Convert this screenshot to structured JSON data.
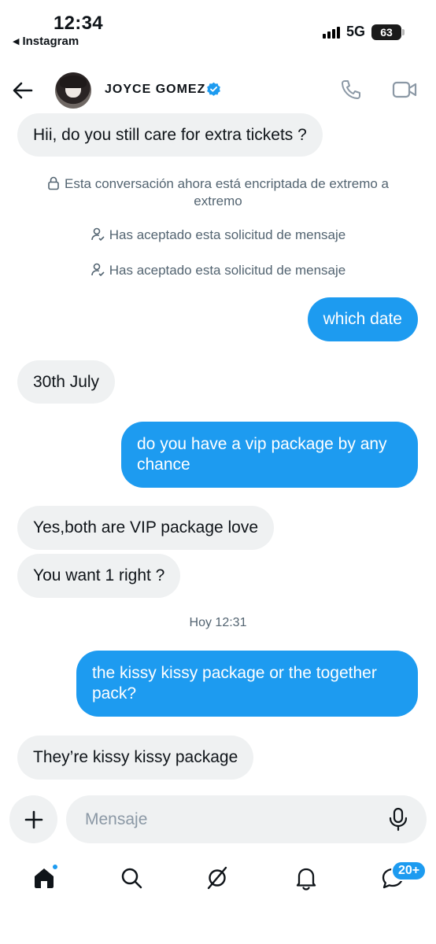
{
  "status_bar": {
    "time": "12:34",
    "back_app": "Instagram",
    "network": "5G",
    "battery": "63"
  },
  "header": {
    "contact_name": "JOYCE GOMEZ"
  },
  "messages": [
    {
      "direction": "incoming",
      "text": "Hii, do you still care for extra tickets ?"
    },
    {
      "direction": "outgoing",
      "text": "which date"
    },
    {
      "direction": "incoming",
      "text": "30th July"
    },
    {
      "direction": "outgoing",
      "text": "do you have a vip package by any chance"
    },
    {
      "direction": "incoming",
      "text": "Yes,both are VIP package love"
    },
    {
      "direction": "incoming",
      "text": "You want 1 right ?"
    },
    {
      "direction": "outgoing",
      "text": "the kissy kissy package or the together pack?"
    },
    {
      "direction": "incoming",
      "text": "They’re kissy kissy package"
    }
  ],
  "notices": {
    "encryption": "Esta conversación ahora está encriptada de extremo a extremo",
    "accepted_1": "Has aceptado esta solicitud de mensaje",
    "accepted_2": "Has aceptado esta solicitud de mensaje"
  },
  "timestamp": "Hoy 12:31",
  "composer": {
    "placeholder": "Mensaje"
  },
  "nav": {
    "messages_badge": "20+"
  },
  "colors": {
    "accent": "#1d9bf0",
    "incoming_bubble": "#eff1f2",
    "secondary_text": "#536471"
  }
}
